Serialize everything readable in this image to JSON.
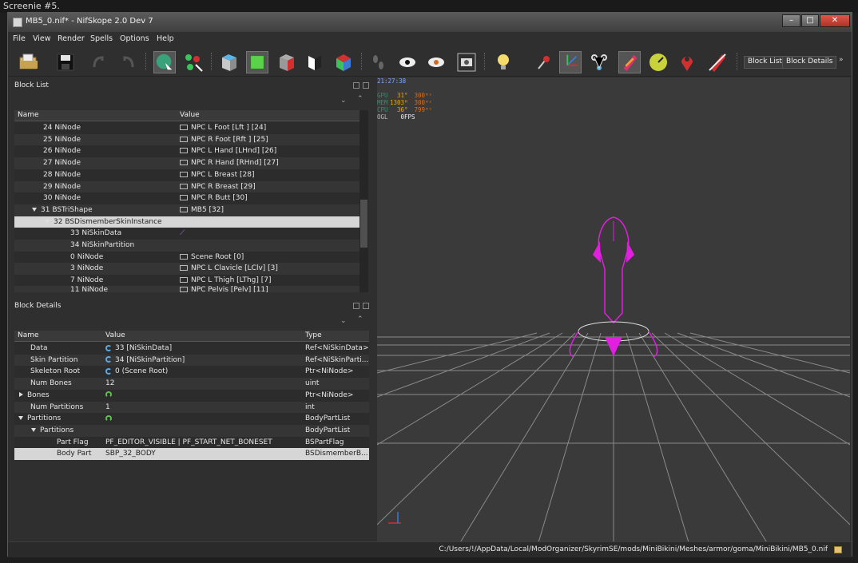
{
  "caption": "Screenie #5.",
  "window": {
    "title": "MB5_0.nif* - NifSkope 2.0 Dev 7",
    "min_glyph": "–",
    "max_glyph": "□",
    "close_glyph": "✕"
  },
  "menu": [
    "File",
    "View",
    "Render",
    "Spells",
    "Options",
    "Help"
  ],
  "toolbar": {
    "block_list_label": "Block List",
    "block_details_label": "Block Details",
    "overflow": "»"
  },
  "block_list": {
    "title": "Block List",
    "columns": [
      "Name",
      "Value"
    ],
    "rows": [
      {
        "name": "24 NiNode",
        "value": "NPC L Foot [Lft ] [24]"
      },
      {
        "name": "25 NiNode",
        "value": "NPC R Foot [Rft ] [25]"
      },
      {
        "name": "26 NiNode",
        "value": "NPC L Hand [LHnd] [26]"
      },
      {
        "name": "27 NiNode",
        "value": "NPC R Hand [RHnd] [27]"
      },
      {
        "name": "28 NiNode",
        "value": "NPC L Breast [28]"
      },
      {
        "name": "29 NiNode",
        "value": "NPC R Breast [29]"
      },
      {
        "name": "30 NiNode",
        "value": "NPC R Butt [30]"
      },
      {
        "name": "31 BSTriShape",
        "value": "MB5 [32]"
      },
      {
        "name": "32 BSDismemberSkinInstance",
        "value": ""
      },
      {
        "name": "33 NiSkinData",
        "value": ""
      },
      {
        "name": "34 NiSkinPartition",
        "value": ""
      },
      {
        "name": "0 NiNode",
        "value": "Scene Root [0]"
      },
      {
        "name": "3 NiNode",
        "value": "NPC L Clavicle [LClv] [3]"
      },
      {
        "name": "7 NiNode",
        "value": "NPC L Thigh [LThg] [7]"
      },
      {
        "name": "11 NiNode",
        "value": "NPC Pelvis [Pelv] [11]"
      }
    ]
  },
  "block_details": {
    "title": "Block Details",
    "columns": [
      "Name",
      "Value",
      "Type"
    ],
    "rows": [
      {
        "name": "Data",
        "value": "33 [NiSkinData]",
        "type": "Ref<NiSkinData>"
      },
      {
        "name": "Skin Partition",
        "value": "34 [NiSkinPartition]",
        "type": "Ref<NiSkinParti..."
      },
      {
        "name": "Skeleton Root",
        "value": "0 (Scene Root)",
        "type": "Ptr<NiNode>"
      },
      {
        "name": "Num Bones",
        "value": "12",
        "type": "uint"
      },
      {
        "name": "Bones",
        "value": "",
        "type": "Ptr<NiNode>"
      },
      {
        "name": "Num Partitions",
        "value": "1",
        "type": "int"
      },
      {
        "name": "Partitions",
        "value": "",
        "type": "BodyPartList"
      },
      {
        "name": "Partitions",
        "value": "",
        "type": "BodyPartList"
      },
      {
        "name": "Part Flag",
        "value": "PF_EDITOR_VISIBLE | PF_START_NET_BONESET",
        "type": "BSPartFlag"
      },
      {
        "name": "Body Part",
        "value": "SBP_32_BODY",
        "type": "BSDismemberB..."
      }
    ]
  },
  "viewport": {
    "time": "21:27:38",
    "stats": [
      {
        "label": "GPU",
        "a": "31",
        "a_unit": "°",
        "b": "300",
        "b_unit": "ᵐˢ"
      },
      {
        "label": "MEM",
        "a": "1303",
        "a_unit": "ᴹ",
        "b": "300",
        "b_unit": "ᵐˢ"
      },
      {
        "label": "CPU",
        "a": "36",
        "a_unit": "°",
        "b": "799",
        "b_unit": "ᵐˢ"
      },
      {
        "label": "OGL",
        "a": "0",
        "a_unit": "FPS",
        "b": "",
        "b_unit": ""
      }
    ],
    "colors": {
      "model": "#e21ee0",
      "grid": "#8a8a8a",
      "bg": "#3a3a3a"
    }
  },
  "status": {
    "path": "C:/Users/!/AppData/Local/ModOrganizer/SkyrimSE/mods/MiniBikini/Meshes/armor/goma/MiniBikini/MB5_0.nif"
  }
}
